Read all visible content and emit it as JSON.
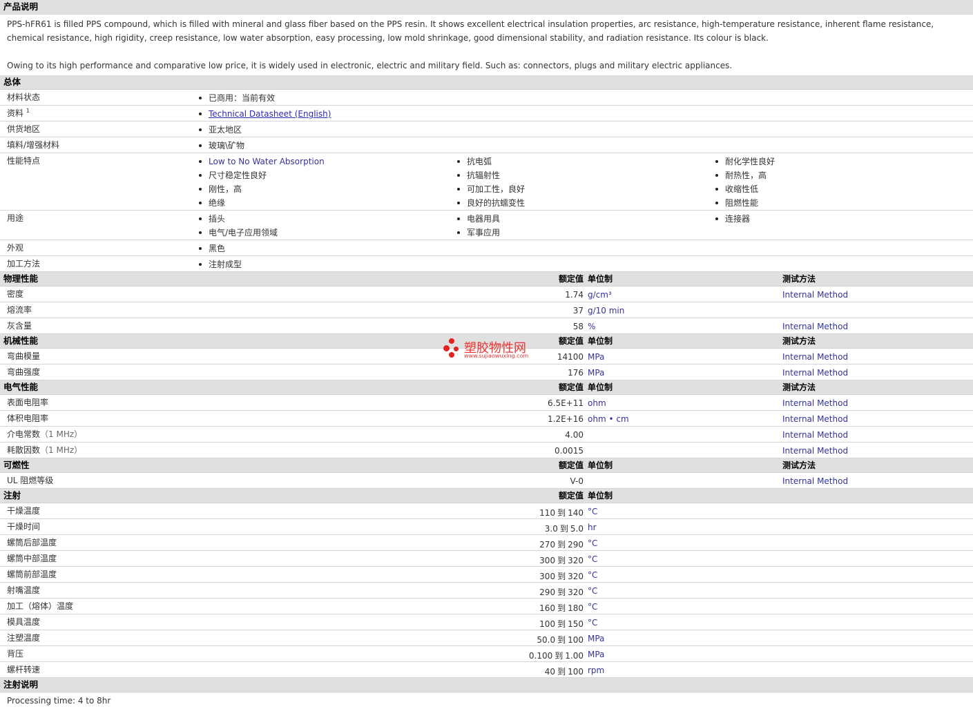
{
  "sections": {
    "desc": "产品说明",
    "general": "总体",
    "physical": "物理性能",
    "mechanical": "机械性能",
    "electrical": "电气性能",
    "flammability": "可燃性",
    "injection": "注射",
    "injection_notes": "注射说明"
  },
  "headers": {
    "nominal": "额定值",
    "unit": "单位制",
    "method": "测试方法"
  },
  "description": {
    "p1": "PPS-hFR61 is filled PPS compound, which is filled with mineral and glass fiber based on the PPS resin. It shows excellent electrical insulation properties, arc resistance, high-temperature resistance, inherent flame resistance, chemical resistance, high rigidity, creep resistance, low water absorption, easy processing, low mold shrinkage, good dimensional stability, and radiation resistance. Its colour is black.",
    "p2": "Owing to its high performance and comparative low price, it is widely used in electronic, electric and military field. Such as: connectors, plugs and military electric appliances."
  },
  "general": {
    "status_label": "材料状态",
    "status": "已商用：当前有效",
    "docs_label": "资料",
    "docs_sup": "1",
    "docs_link": "Technical Datasheet (English)",
    "region_label": "供货地区",
    "region": "亚太地区",
    "filler_label": "填料/增强材料",
    "filler": "玻璃\\矿物",
    "features_label": "性能特点",
    "features": [
      [
        "Low to No Water Absorption",
        "尺寸稳定性良好",
        "刚性，高",
        "绝缘"
      ],
      [
        "抗电弧",
        "抗辐射性",
        "可加工性，良好",
        "良好的抗蠕变性"
      ],
      [
        "耐化学性良好",
        "耐热性，高",
        "收缩性低",
        "阻燃性能"
      ]
    ],
    "uses_label": "用途",
    "uses": [
      [
        "插头",
        "电气/电子应用领域"
      ],
      [
        "电器用具",
        "军事应用"
      ],
      [
        "连接器"
      ]
    ],
    "appearance_label": "外观",
    "appearance": "黑色",
    "process_label": "加工方法",
    "process": "注射成型"
  },
  "physical": [
    {
      "name": "密度",
      "value": "1.74",
      "unit": "g/cm³",
      "method": "Internal Method"
    },
    {
      "name": "熔流率",
      "value": "37",
      "unit": "g/10 min",
      "method": ""
    },
    {
      "name": "灰含量",
      "value": "58",
      "unit": "%",
      "method": "Internal Method"
    }
  ],
  "mechanical": [
    {
      "name": "弯曲模量",
      "value": "14100",
      "unit": "MPa",
      "method": "Internal Method"
    },
    {
      "name": "弯曲强度",
      "value": "176",
      "unit": "MPa",
      "method": "Internal Method"
    }
  ],
  "electrical": [
    {
      "name": "表面电阻率",
      "value": "6.5E+11",
      "unit": "ohm",
      "method": "Internal Method"
    },
    {
      "name": "体积电阻率",
      "value": "1.2E+16",
      "unit": "ohm • cm",
      "method": "Internal Method"
    },
    {
      "name": "介电常数",
      "cond": "（1 MHz）",
      "value": "4.00",
      "unit": "",
      "method": "Internal Method"
    },
    {
      "name": "耗散因数",
      "cond": "（1 MHz）",
      "value": "0.0015",
      "unit": "",
      "method": "Internal Method"
    }
  ],
  "flammability": [
    {
      "name": "UL 阻燃等级",
      "value": "V-0",
      "unit": "",
      "method": "Internal Method"
    }
  ],
  "injection": [
    {
      "name": "干燥温度",
      "lo": "110",
      "hi": "140",
      "unit": "°C"
    },
    {
      "name": "干燥时间",
      "lo": "3.0",
      "hi": "5.0",
      "unit": "hr"
    },
    {
      "name": "螺筒后部温度",
      "lo": "270",
      "hi": "290",
      "unit": "°C"
    },
    {
      "name": "螺筒中部温度",
      "lo": "300",
      "hi": "320",
      "unit": "°C"
    },
    {
      "name": "螺筒前部温度",
      "lo": "300",
      "hi": "320",
      "unit": "°C"
    },
    {
      "name": "射嘴温度",
      "lo": "290",
      "hi": "320",
      "unit": "°C"
    },
    {
      "name": "加工（熔体）温度",
      "lo": "160",
      "hi": "180",
      "unit": "°C"
    },
    {
      "name": "模具温度",
      "lo": "100",
      "hi": "150",
      "unit": "°C"
    },
    {
      "name": "注塑温度",
      "lo": "50.0",
      "hi": "100",
      "unit": "MPa"
    },
    {
      "name": "背压",
      "lo": "0.100",
      "hi": "1.00",
      "unit": "MPa"
    },
    {
      "name": "螺杆转速",
      "lo": "40",
      "hi": "100",
      "unit": "rpm"
    }
  ],
  "range_word": "到",
  "injection_note": "Processing time: 4 to 8hr",
  "watermark": {
    "text": "塑胶物性网",
    "url": "www.sujiaowuxing.com",
    "color": "#e32222"
  }
}
